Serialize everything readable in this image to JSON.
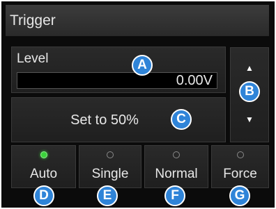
{
  "title": "Trigger",
  "level": {
    "label": "Level",
    "value": "0.00V"
  },
  "set50_label": "Set to 50%",
  "modes": [
    {
      "label": "Auto",
      "led_on": true
    },
    {
      "label": "Single",
      "led_on": false
    },
    {
      "label": "Normal",
      "led_on": false
    },
    {
      "label": "Force",
      "led_on": false
    }
  ],
  "callouts": {
    "a": "A",
    "b": "B",
    "c": "C",
    "d": "D",
    "e": "E",
    "f": "F",
    "g": "G"
  },
  "colors": {
    "callout": "#2f84d8",
    "led_on": "#3bd43b",
    "panel": "#0b0b0b"
  }
}
